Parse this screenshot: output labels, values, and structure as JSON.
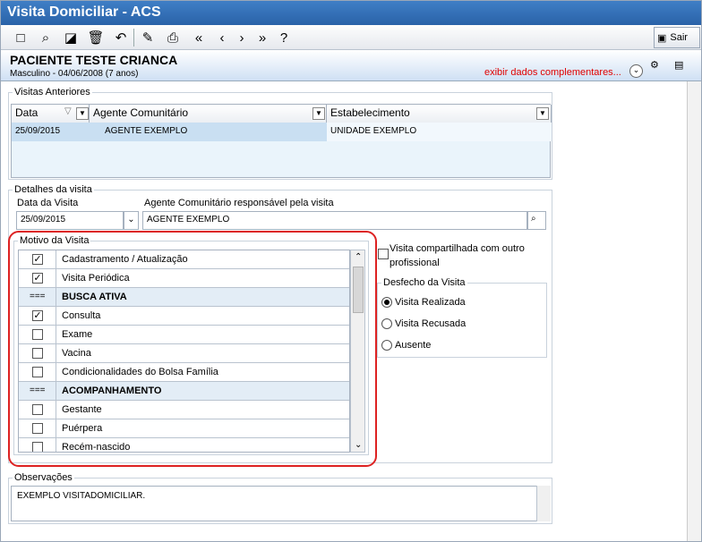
{
  "window": {
    "title": "Visita Domiciliar - ACS"
  },
  "toolbar": {
    "exit_label": "Sair"
  },
  "patient": {
    "name": "PACIENTE TESTE CRIANCA",
    "info": "Masculino - 04/06/2008 (7 anos)",
    "more_label": "exibir dados complementares..."
  },
  "previous_visits": {
    "title": "Visitas Anteriores",
    "headers": [
      "Data",
      "Agente Comunitário",
      "Estabelecimento"
    ],
    "row": {
      "date": "25/09/2015",
      "agent": "AGENTE EXEMPLO",
      "establishment": "UNIDADE EXEMPLO"
    }
  },
  "visit_details": {
    "title": "Detalhes da visita",
    "date_label": "Data da Visita",
    "date_value": "25/09/2015",
    "agent_label": "Agente Comunitário responsável pela visita",
    "agent_value": "AGENTE EXEMPLO"
  },
  "reason": {
    "title": "Motivo da Visita",
    "rows": [
      {
        "label": "Cadastramento / Atualização",
        "mark": "✓"
      },
      {
        "label": "Visita Periódica",
        "mark": "✓"
      },
      {
        "label": "BUSCA ATIVA",
        "mark": "==="
      },
      {
        "label": "Consulta",
        "mark": "✓"
      },
      {
        "label": "Exame",
        "mark": ""
      },
      {
        "label": "Vacina",
        "mark": ""
      },
      {
        "label": "Condicionalidades do Bolsa Família",
        "mark": ""
      },
      {
        "label": "ACOMPANHAMENTO",
        "mark": "==="
      },
      {
        "label": "Gestante",
        "mark": ""
      },
      {
        "label": "Puérpera",
        "mark": ""
      },
      {
        "label": "Recém-nascido",
        "mark": ""
      }
    ]
  },
  "shared_visit": {
    "label": "Visita compartilhada com outro profissional"
  },
  "outcome": {
    "title": "Desfecho da Visita",
    "options": [
      "Visita Realizada",
      "Visita Recusada",
      "Ausente"
    ]
  },
  "notes": {
    "title": "Observações",
    "value": "EXEMPLO VISITADOMICILIAR."
  }
}
